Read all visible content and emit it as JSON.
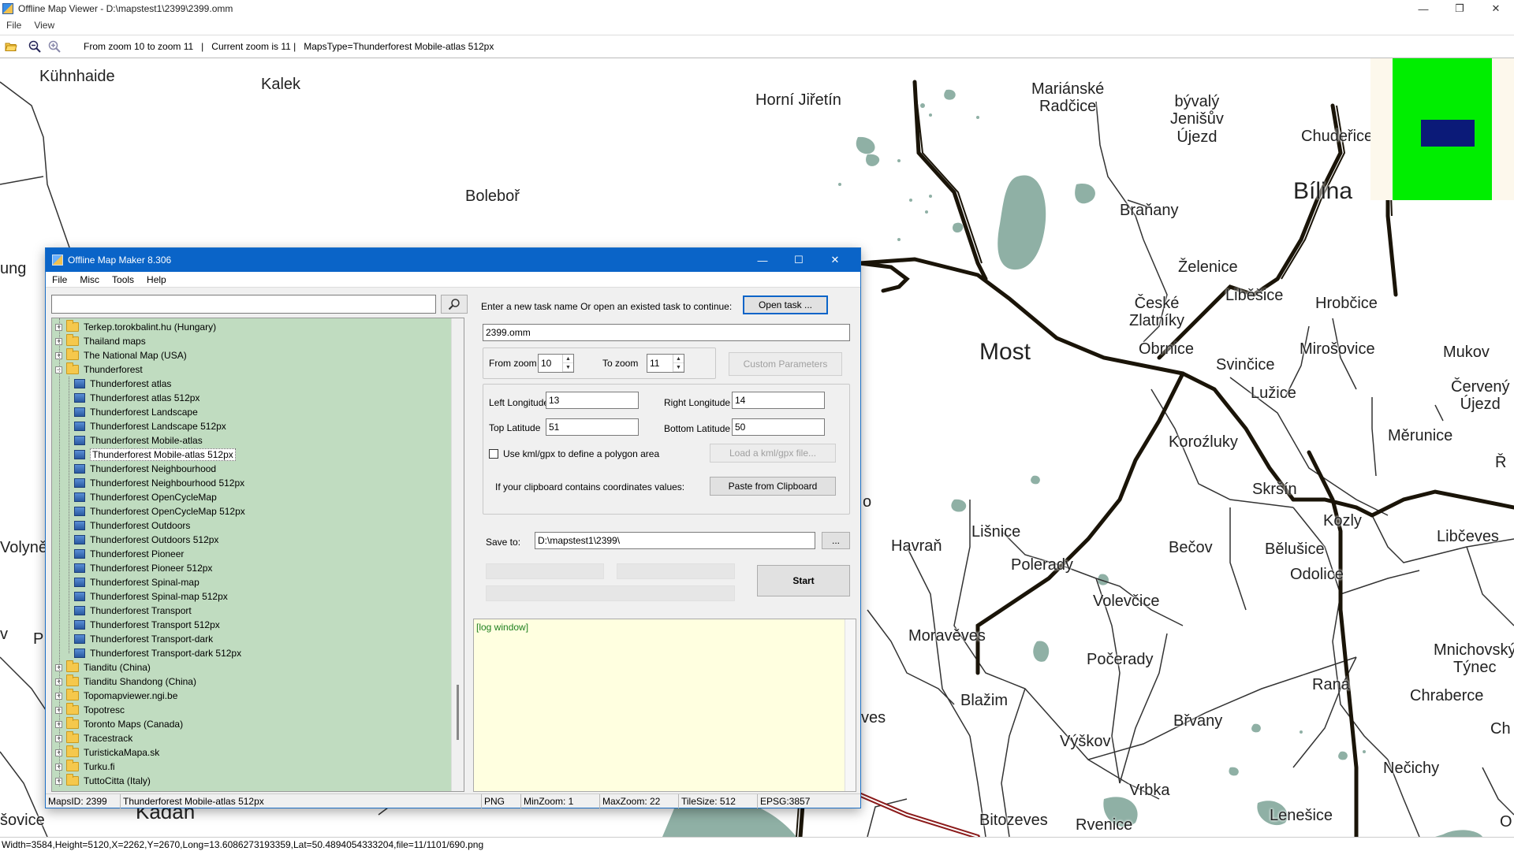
{
  "viewer": {
    "title": "Offline Map Viewer - D:\\mapstest1\\2399\\2399.omm",
    "menu": [
      "File",
      "View"
    ],
    "toolbar_text": "From zoom 10 to zoom 11   |   Current zoom is 11 |   MapsType=Thunderforest Mobile-atlas 512px",
    "status": "Width=3584,Height=5120,X=2262,Y=2670,Long=13.6086273193359,Lat=50.4894054333204,file=11/1101/690.png"
  },
  "map": {
    "places": [
      "Kühnhaide",
      "Kalek",
      "Boleboř",
      "Horní Jiřetín",
      "Mariánské\nRadčice",
      "bývalý\nJenišův\nÚjezd",
      "Chudeřice",
      "Bílina",
      "Braňany",
      "Želenice",
      "Liběšice",
      "České\nZlatníky",
      "Hrobčice",
      "Obrnice",
      "Most",
      "Mirošovice",
      "Mukov",
      "Svinčice",
      "Lužice",
      "Červený\nÚjezd",
      "Koroźluky",
      "Měrunice",
      "Skršín",
      "Kozly",
      "Bělušice",
      "Libčeves",
      "Odolice",
      "Lišnice",
      "Havraň",
      "Bečov",
      "Polerady",
      "Volevčice",
      "Moravěves",
      "Počerady",
      "Blažim",
      "Mnichovský\nTýnec",
      "Raná",
      "Chraberce",
      "Břvany",
      "Výškov",
      "Vrbka",
      "Nečichy",
      "Bitozeves",
      "Rvenice",
      "Lenešice",
      "Kadaň",
      "ung",
      "Volyně",
      "šovice",
      "ves",
      "o",
      "Ch",
      "Ř",
      "v",
      "P",
      "O"
    ]
  },
  "dialog": {
    "title": "Offline Map Maker 8.306",
    "menu": [
      "File",
      "Misc",
      "Tools",
      "Help"
    ],
    "search": {
      "value": "",
      "placeholder": ""
    },
    "tree": [
      {
        "label": "Terkep.torokbalint.hu (Hungary)",
        "kind": "folder",
        "expander": "+"
      },
      {
        "label": "Thailand maps",
        "kind": "folder",
        "expander": "+"
      },
      {
        "label": "The National Map (USA)",
        "kind": "folder",
        "expander": "+"
      },
      {
        "label": "Thunderforest",
        "kind": "folder-open",
        "expander": "−"
      },
      {
        "label": "Thunderforest atlas",
        "kind": "map"
      },
      {
        "label": "Thunderforest atlas 512px",
        "kind": "map"
      },
      {
        "label": "Thunderforest Landscape",
        "kind": "map"
      },
      {
        "label": "Thunderforest Landscape 512px",
        "kind": "map"
      },
      {
        "label": "Thunderforest Mobile-atlas",
        "kind": "map"
      },
      {
        "label": "Thunderforest Mobile-atlas 512px",
        "kind": "map",
        "selected": true
      },
      {
        "label": "Thunderforest Neighbourhood",
        "kind": "map"
      },
      {
        "label": "Thunderforest Neighbourhood 512px",
        "kind": "map"
      },
      {
        "label": "Thunderforest OpenCycleMap",
        "kind": "map"
      },
      {
        "label": "Thunderforest OpenCycleMap 512px",
        "kind": "map"
      },
      {
        "label": "Thunderforest Outdoors",
        "kind": "map"
      },
      {
        "label": "Thunderforest Outdoors 512px",
        "kind": "map"
      },
      {
        "label": "Thunderforest Pioneer",
        "kind": "map"
      },
      {
        "label": "Thunderforest Pioneer 512px",
        "kind": "map"
      },
      {
        "label": "Thunderforest Spinal-map",
        "kind": "map"
      },
      {
        "label": "Thunderforest Spinal-map 512px",
        "kind": "map"
      },
      {
        "label": "Thunderforest Transport",
        "kind": "map"
      },
      {
        "label": "Thunderforest Transport 512px",
        "kind": "map"
      },
      {
        "label": "Thunderforest Transport-dark",
        "kind": "map"
      },
      {
        "label": "Thunderforest Transport-dark 512px",
        "kind": "map"
      },
      {
        "label": "Tianditu (China)",
        "kind": "folder",
        "expander": "+"
      },
      {
        "label": "Tianditu Shandong (China)",
        "kind": "folder",
        "expander": "+"
      },
      {
        "label": "Topomapviewer.ngi.be",
        "kind": "folder",
        "expander": "+"
      },
      {
        "label": "Topotresc",
        "kind": "folder",
        "expander": "+"
      },
      {
        "label": "Toronto Maps (Canada)",
        "kind": "folder",
        "expander": "+"
      },
      {
        "label": "Tracestrack",
        "kind": "folder",
        "expander": "+"
      },
      {
        "label": "TuristickaMapa.sk",
        "kind": "folder",
        "expander": "+"
      },
      {
        "label": "Turku.fi",
        "kind": "folder",
        "expander": "+"
      },
      {
        "label": "TuttoCitta (Italy)",
        "kind": "folder",
        "expander": "+"
      }
    ],
    "form": {
      "task_prompt": "Enter a new task name Or open an existed task to continue:",
      "open_task_button": "Open task ...",
      "task_name": "2399.omm",
      "from_zoom_label": "From zoom",
      "from_zoom_value": "10",
      "to_zoom_label": "To zoom",
      "to_zoom_value": "11",
      "custom_params_button": "Custom Parameters",
      "left_longitude_label": "Left Longitude",
      "left_longitude_value": "13",
      "right_longitude_label": "Right Longitude",
      "right_longitude_value": "14",
      "top_latitude_label": "Top Latitude",
      "top_latitude_value": "51",
      "bottom_latitude_label": "Bottom Latitude",
      "bottom_latitude_value": "50",
      "kml_checkbox_label": "Use kml/gpx to define a polygon area",
      "kml_checked": false,
      "load_kml_button": "Load a kml/gpx file...",
      "clipboard_label": "If your clipboard contains coordinates values:",
      "paste_button": "Paste from Clipboard",
      "save_to_label": "Save to:",
      "save_to_value": "D:\\mapstest1\\2399\\",
      "browse_button": "...",
      "start_button": "Start",
      "log_text": "[log window]"
    },
    "status": {
      "maps_id": "MapsID: 2399",
      "map_name": "Thunderforest Mobile-atlas 512px",
      "format": "PNG",
      "min_zoom": "MinZoom: 1",
      "max_zoom": "MaxZoom: 22",
      "tile_size": "TileSize: 512",
      "epsg": "EPSG:3857"
    }
  },
  "colors": {
    "dialog_title_bg": "#0a64c8",
    "tree_bg": "#c0dcc0",
    "log_bg": "#ffffe0",
    "water": "#8fb0a5",
    "minimap_green": "#00ee00",
    "minimap_viewport": "#0b1a78",
    "rail_red": "#8b1a1a"
  }
}
